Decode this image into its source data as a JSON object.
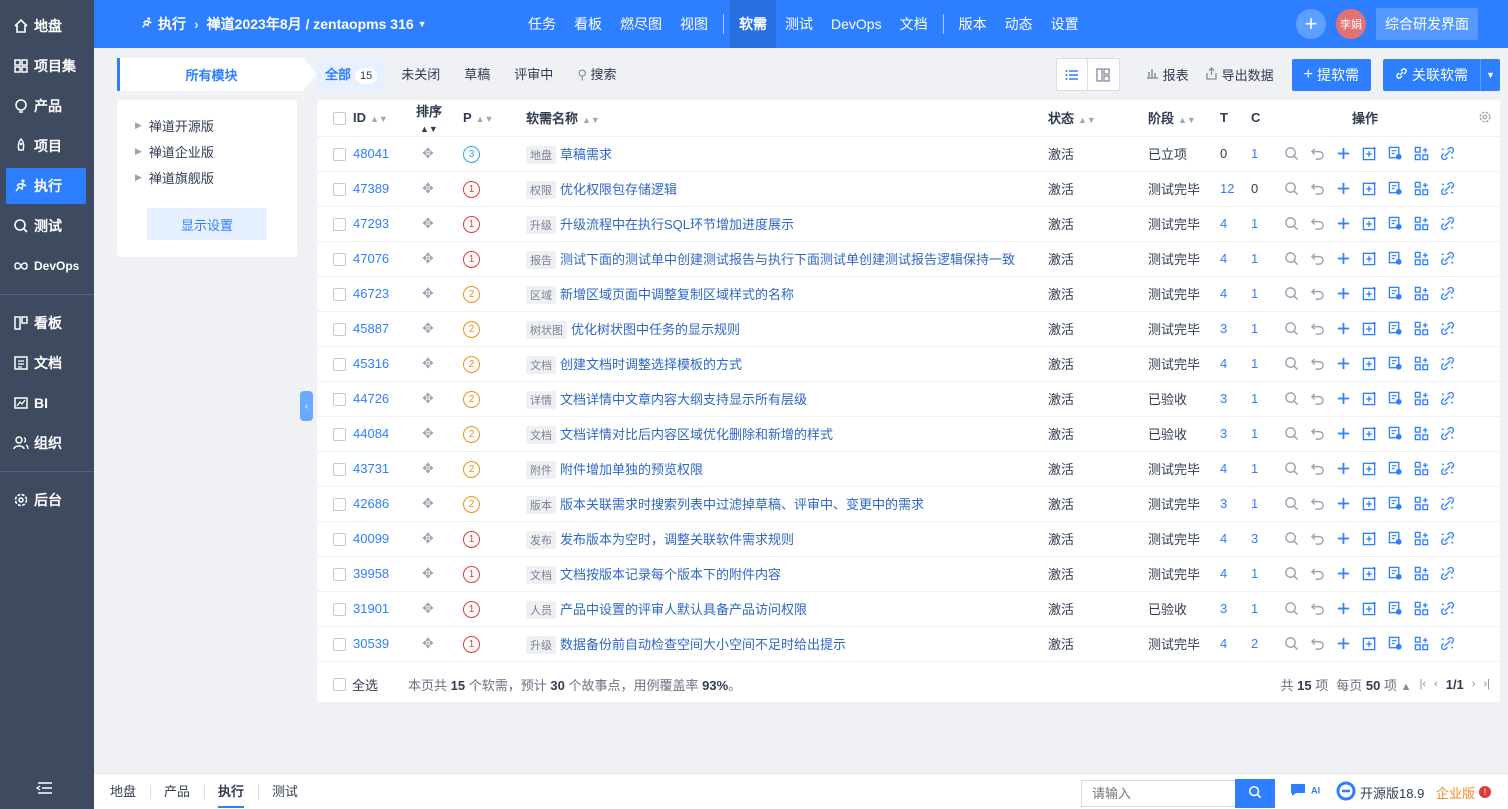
{
  "sidebar": {
    "items": [
      {
        "label": "地盘",
        "icon": "home-icon"
      },
      {
        "label": "项目集",
        "icon": "grid-icon"
      },
      {
        "label": "产品",
        "icon": "bulb-icon"
      },
      {
        "label": "项目",
        "icon": "rocket-icon"
      },
      {
        "label": "执行",
        "icon": "run-icon"
      },
      {
        "label": "测试",
        "icon": "magnifier-icon"
      },
      {
        "label": "DevOps",
        "icon": "infinity-icon"
      }
    ],
    "items2": [
      {
        "label": "看板",
        "icon": "kanban-icon"
      },
      {
        "label": "文档",
        "icon": "doc-icon"
      },
      {
        "label": "BI",
        "icon": "chart-icon"
      },
      {
        "label": "组织",
        "icon": "people-icon"
      }
    ],
    "items3": [
      {
        "label": "后台",
        "icon": "gear-icon"
      }
    ],
    "active": "执行"
  },
  "header": {
    "module": "执行",
    "project": "禅道2023年8月 / zentaopms 316",
    "nav": [
      "任务",
      "看板",
      "燃尽图",
      "视图"
    ],
    "nav_active": "软需",
    "nav2": [
      "测试",
      "DevOps",
      "文档"
    ],
    "nav3": [
      "版本",
      "动态",
      "设置"
    ],
    "user": "李娟",
    "ui_switch": "综合研发界面"
  },
  "modules": {
    "tab": "所有模块",
    "items": [
      "禅道开源版",
      "禅道企业版",
      "禅道旗舰版"
    ],
    "display_settings": "显示设置"
  },
  "toolbar": {
    "filters": [
      {
        "label": "全部",
        "count": "15"
      },
      {
        "label": "未关闭"
      },
      {
        "label": "草稿"
      },
      {
        "label": "评审中"
      }
    ],
    "search": "搜索",
    "report": "报表",
    "export": "导出数据",
    "create": "提软需",
    "link": "关联软需"
  },
  "table": {
    "headers": {
      "id": "ID",
      "order": "排序",
      "pri": "P",
      "name": "软需名称",
      "status": "状态",
      "stage": "阶段",
      "t": "T",
      "c": "C",
      "ops": "操作"
    },
    "rows": [
      {
        "id": "48041",
        "pri": "3",
        "tag": "地盘",
        "title": "草稿需求",
        "status": "激活",
        "stage": "已立项",
        "t": "0",
        "c": "1"
      },
      {
        "id": "47389",
        "pri": "1",
        "tag": "权限",
        "title": "优化权限包存储逻辑",
        "status": "激活",
        "stage": "测试完毕",
        "t": "12",
        "c": "0"
      },
      {
        "id": "47293",
        "pri": "1",
        "tag": "升级",
        "title": "升级流程中在执行SQL环节增加进度展示",
        "status": "激活",
        "stage": "测试完毕",
        "t": "4",
        "c": "1"
      },
      {
        "id": "47076",
        "pri": "1",
        "tag": "报告",
        "title": "测试下面的测试单中创建测试报告与执行下面测试单创建测试报告逻辑保持一致",
        "status": "激活",
        "stage": "测试完毕",
        "t": "4",
        "c": "1"
      },
      {
        "id": "46723",
        "pri": "2",
        "tag": "区域",
        "title": "新增区域页面中调整复制区域样式的名称",
        "status": "激活",
        "stage": "测试完毕",
        "t": "4",
        "c": "1"
      },
      {
        "id": "45887",
        "pri": "2",
        "tag": "树状图",
        "title": "优化树状图中任务的显示规则",
        "status": "激活",
        "stage": "测试完毕",
        "t": "3",
        "c": "1"
      },
      {
        "id": "45316",
        "pri": "2",
        "tag": "文档",
        "title": "创建文档时调整选择模板的方式",
        "status": "激活",
        "stage": "测试完毕",
        "t": "4",
        "c": "1"
      },
      {
        "id": "44726",
        "pri": "2",
        "tag": "详情",
        "title": "文档详情中文章内容大纲支持显示所有层级",
        "status": "激活",
        "stage": "已验收",
        "t": "3",
        "c": "1"
      },
      {
        "id": "44084",
        "pri": "2",
        "tag": "文档",
        "title": "文档详情对比后内容区域优化删除和新增的样式",
        "status": "激活",
        "stage": "已验收",
        "t": "3",
        "c": "1"
      },
      {
        "id": "43731",
        "pri": "2",
        "tag": "附件",
        "title": "附件增加单独的预览权限",
        "status": "激活",
        "stage": "测试完毕",
        "t": "4",
        "c": "1"
      },
      {
        "id": "42686",
        "pri": "2",
        "tag": "版本",
        "title": "版本关联需求时搜索列表中过滤掉草稿、评审中、变更中的需求",
        "status": "激活",
        "stage": "测试完毕",
        "t": "3",
        "c": "1"
      },
      {
        "id": "40099",
        "pri": "1",
        "tag": "发布",
        "title": "发布版本为空时，调整关联软件需求规则",
        "status": "激活",
        "stage": "测试完毕",
        "t": "4",
        "c": "3"
      },
      {
        "id": "39958",
        "pri": "1",
        "tag": "文档",
        "title": "文档按版本记录每个版本下的附件内容",
        "status": "激活",
        "stage": "测试完毕",
        "t": "4",
        "c": "1"
      },
      {
        "id": "31901",
        "pri": "1",
        "tag": "人员",
        "title": "产品中设置的评审人默认具备产品访问权限",
        "status": "激活",
        "stage": "已验收",
        "t": "3",
        "c": "1"
      },
      {
        "id": "30539",
        "pri": "1",
        "tag": "升级",
        "title": "数据备份前自动检查空间大小空间不足时给出提示",
        "status": "激活",
        "stage": "测试完毕",
        "t": "4",
        "c": "2"
      }
    ],
    "footer": {
      "select_all": "全选",
      "summary_prefix": "本页共",
      "summary_count": "15",
      "summary_mid": "个软需，预计",
      "summary_points": "30",
      "summary_suffix": "个故事点，用例覆盖率",
      "summary_rate": "93%",
      "summary_end": "。",
      "total_prefix": "共",
      "total": "15",
      "total_suffix": "项",
      "per_page_prefix": "每页",
      "per_page": "50",
      "per_page_suffix": "项",
      "page": "1/1"
    }
  },
  "bottom": {
    "tabs": [
      "地盘",
      "产品",
      "执行",
      "测试"
    ],
    "active": "执行",
    "search_placeholder": "请输入",
    "ai": "AI",
    "version": "开源版18.9",
    "edition": "企业版",
    "edition_badge": "!"
  },
  "colors": {
    "primary": "#2e7fff",
    "sidebar": "#3d4a5f",
    "p1": "#e03b3b",
    "p2": "#f08d1b",
    "p3": "#2ea7e0"
  }
}
